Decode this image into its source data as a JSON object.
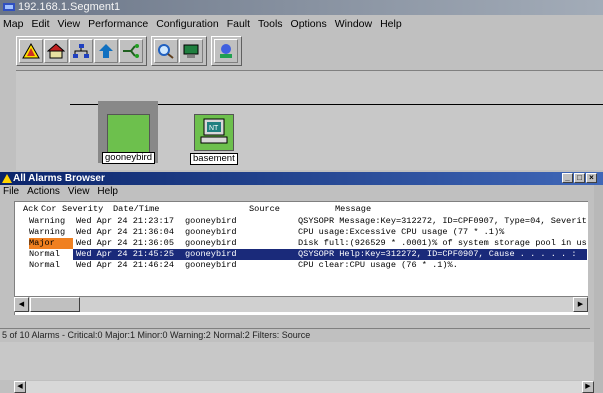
{
  "main_window": {
    "title": "192.168.1.Segment1",
    "menu": [
      "Map",
      "Edit",
      "View",
      "Performance",
      "Configuration",
      "Fault",
      "Tools",
      "Options",
      "Window",
      "Help"
    ]
  },
  "toolbar": {
    "icons": [
      "alarm-triangle-icon",
      "home-icon",
      "network-icon",
      "up-arrow-icon",
      "connect-icon",
      "zoom-icon",
      "monitor-icon",
      "tool-icon"
    ]
  },
  "map": {
    "nodes": [
      {
        "label": "gooneybird",
        "color": "#6dc04d"
      },
      {
        "label": "basement",
        "color": "#6dc04d",
        "badge": "NT"
      }
    ]
  },
  "alarms_window": {
    "title": "All Alarms Browser",
    "menu": [
      "File",
      "Actions",
      "View",
      "Help"
    ],
    "columns": {
      "ack": "Ack",
      "cor": "Cor",
      "severity": "Severity",
      "date": "Date/Time",
      "source": "Source",
      "message": "Message"
    },
    "rows": [
      {
        "severity": "Warning",
        "date": "Wed Apr 24 21:23:17",
        "source": "gooneybird",
        "message": "QSYSOPR Message:Key=312272, ID=CPF0907, Type=04, Severit"
      },
      {
        "severity": "Warning",
        "date": "Wed Apr 24 21:36:04",
        "source": "gooneybird",
        "message": "CPU usage:Excessive CPU usage (77 * .1)%"
      },
      {
        "severity": "Major",
        "date": "Wed Apr 24 21:36:05",
        "source": "gooneybird",
        "message": "Disk full:(926529 * .0001)% of system storage pool in us"
      },
      {
        "severity": "Normal",
        "date": "Wed Apr 24 21:45:25",
        "source": "gooneybird",
        "message": "QSYSOPR Help:Key=312272, ID=CPF0907, Cause . . . . . :"
      },
      {
        "severity": "Normal",
        "date": "Wed Apr 24 21:46:24",
        "source": "gooneybird",
        "message": "CPU clear:CPU usage (76 * .1)%."
      }
    ],
    "status": "5 of 10 Alarms -  Critical:0  Major:1  Minor:0  Warning:2  Normal:2   Filters: Source"
  },
  "colors": {
    "major": "#f08020",
    "selected": "#1a2a7a",
    "node": "#6dc04d"
  }
}
